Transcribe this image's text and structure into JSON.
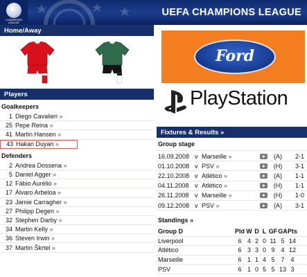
{
  "header": {
    "logo_text": "CHAMPIONS LEAGUE",
    "title": "UEFA CHAMPIONS LEAGUE"
  },
  "home_away": {
    "title": "Home/Away"
  },
  "players": {
    "title": "Players",
    "goalkeepers_label": "Goalkeepers",
    "goalkeepers": [
      {
        "num": "1",
        "name": "Diego Cavalieri"
      },
      {
        "num": "25",
        "name": "Pepe Reina"
      },
      {
        "num": "41",
        "name": "Martin Hansen"
      },
      {
        "num": "43",
        "name": "Hakan Duyan"
      }
    ],
    "defenders_label": "Defenders",
    "defenders": [
      {
        "num": "2",
        "name": "Andrea Dossena"
      },
      {
        "num": "5",
        "name": "Daniel Agger"
      },
      {
        "num": "12",
        "name": "Fábio Aurélio"
      },
      {
        "num": "17",
        "name": "Álvaro Arbeloa"
      },
      {
        "num": "23",
        "name": "Jamie Carragher"
      },
      {
        "num": "27",
        "name": "Philipp Degen"
      },
      {
        "num": "32",
        "name": "Stephen Darby"
      },
      {
        "num": "34",
        "name": "Martin Kelly"
      },
      {
        "num": "36",
        "name": "Steven Irwin"
      },
      {
        "num": "37",
        "name": "Martin Škrtel"
      }
    ]
  },
  "ads": {
    "ford": "Ford",
    "playstation": "PlayStation",
    "playstation_mark": "PS",
    "playstation_tm": "®"
  },
  "fixtures": {
    "title": "Fixtures & Results »",
    "stage": "Group stage",
    "rows": [
      {
        "date": "16.09.2008",
        "vs": "v",
        "opponent": "Marseille",
        "ha": "(A)",
        "score": "2-1"
      },
      {
        "date": "01.10.2008",
        "vs": "v",
        "opponent": "PSV",
        "ha": "(H)",
        "score": "3-1"
      },
      {
        "date": "22.10.2008",
        "vs": "v",
        "opponent": "Atlético",
        "ha": "(A)",
        "score": "1-1"
      },
      {
        "date": "04.11.2008",
        "vs": "v",
        "opponent": "Atlético",
        "ha": "(H)",
        "score": "1-1"
      },
      {
        "date": "26.11.2008",
        "vs": "v",
        "opponent": "Marseille",
        "ha": "(H)",
        "score": "1-0"
      },
      {
        "date": "09.12.2008",
        "vs": "v",
        "opponent": "PSV",
        "ha": "(A)",
        "score": "3-1"
      }
    ]
  },
  "standings": {
    "title": "Standings",
    "header": {
      "team": "Group D",
      "pld": "Pld",
      "w": "W",
      "d": "D",
      "l": "L",
      "gf": "GF",
      "ga": "GA",
      "pts": "Pts"
    },
    "rows": [
      {
        "team": "Liverpool",
        "pld": "6",
        "w": "4",
        "d": "2",
        "l": "0",
        "gf": "11",
        "ga": "5",
        "pts": "14"
      },
      {
        "team": "Atlético",
        "pld": "6",
        "w": "3",
        "d": "3",
        "l": "0",
        "gf": "9",
        "ga": "4",
        "pts": "12"
      },
      {
        "team": "Marseille",
        "pld": "6",
        "w": "1",
        "d": "1",
        "l": "4",
        "gf": "5",
        "ga": "7",
        "pts": "4"
      },
      {
        "team": "PSV",
        "pld": "6",
        "w": "1",
        "d": "0",
        "l": "5",
        "gf": "5",
        "ga": "13",
        "pts": "3"
      }
    ]
  },
  "colors": {
    "header_bg": "#17306b",
    "ford_bg": "#f47d20",
    "home_kit": "#d8111c",
    "away_kit": "#2f6b4c",
    "highlight_border": "#d9534f"
  }
}
